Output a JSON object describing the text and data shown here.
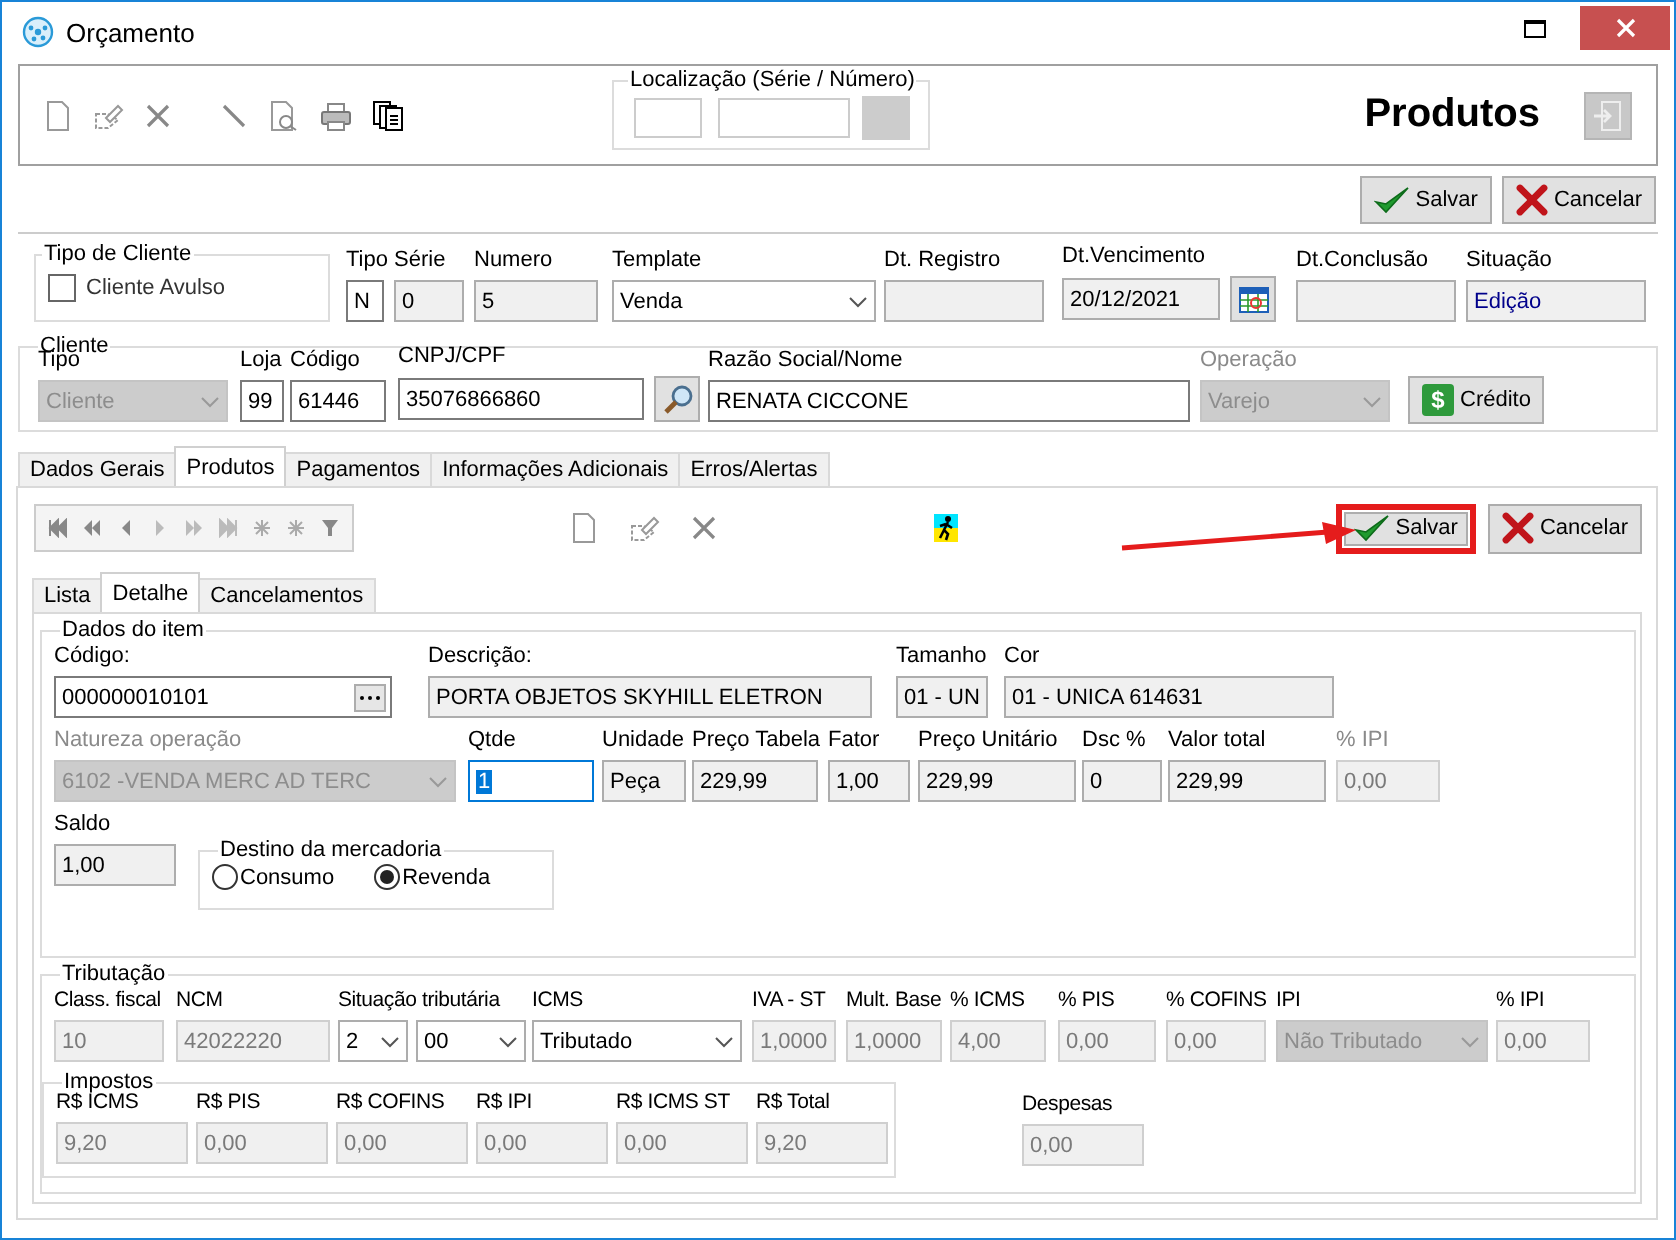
{
  "window": {
    "title": "Orçamento"
  },
  "location": {
    "legend": "Localização (Série / Número)"
  },
  "heading": "Produtos",
  "form_buttons": [
    {
      "kind": "save",
      "label": "Salvar",
      "highlighted": false
    },
    {
      "kind": "cancel",
      "label": "Cancelar",
      "highlighted": false
    }
  ],
  "client_type": {
    "legend": "Tipo de Cliente",
    "label": "Cliente Avulso",
    "checked": false
  },
  "header_fields": [
    {
      "label": "Tipo Série",
      "value": "N",
      "kind": "input"
    },
    {
      "value": "0",
      "kind": "readonly"
    },
    {
      "label": "Numero",
      "value": "5",
      "kind": "readonly"
    },
    {
      "label": "Template",
      "value": "Venda",
      "kind": "select"
    },
    {
      "label": "Dt. Registro",
      "kind": "readonly"
    },
    {
      "label": "Dt.Vencimento",
      "value": "20/12/2021",
      "kind": "date"
    },
    {
      "label": "Dt.Conclusão",
      "kind": "readonly"
    },
    {
      "label": "Situação",
      "value": "Edição",
      "kind": "status"
    }
  ],
  "client": {
    "legend": "Cliente",
    "fields": [
      {
        "label": "Tipo",
        "value": "Cliente",
        "kind": "select_disabled"
      },
      {
        "label": "Loja",
        "value": "99",
        "kind": "input"
      },
      {
        "label": "Código",
        "value": "61446",
        "kind": "input"
      },
      {
        "label": "CNPJ/CPF",
        "value": "35076866860",
        "kind": "search"
      },
      {
        "label": "Razão Social/Nome",
        "value": "RENATA CICCONE",
        "kind": "input"
      },
      {
        "label": "Operação",
        "value": "Varejo",
        "kind": "select_disabled",
        "label_greyed": true
      }
    ],
    "credit_button": "Crédito",
    "credit_icon": "$"
  },
  "tabs": [
    {
      "label": "Dados Gerais",
      "selected": false
    },
    {
      "label": "Produtos",
      "selected": true
    },
    {
      "label": "Pagamentos",
      "selected": false
    },
    {
      "label": "Informações Adicionais",
      "selected": false
    },
    {
      "label": "Erros/Alertas",
      "selected": false
    }
  ],
  "item_buttons": [
    {
      "kind": "save",
      "label": "Salvar",
      "highlighted": true
    },
    {
      "kind": "cancel",
      "label": "Cancelar",
      "highlighted": false
    }
  ],
  "subtabs": [
    {
      "label": "Lista",
      "selected": false
    },
    {
      "label": "Detalhe",
      "selected": true
    },
    {
      "label": "Cancelamentos",
      "selected": false
    }
  ],
  "item": {
    "legend": "Dados do item",
    "product_fields": [
      {
        "label": "Código:",
        "value": "000000010101",
        "kind": "lookup"
      },
      {
        "label": "Descrição:",
        "value": "PORTA OBJETOS SKYHILL ELETRON",
        "kind": "readonly"
      },
      {
        "label": "Tamanho",
        "value": "01 - UN",
        "kind": "readonly"
      },
      {
        "label": "Cor",
        "value": "01 - UNICA 614631",
        "kind": "readonly"
      }
    ],
    "value_fields": [
      {
        "label": "Natureza operação",
        "value": "6102 -VENDA MERC AD TERC",
        "kind": "select_disabled",
        "label_greyed": true
      },
      {
        "label": "Qtde",
        "value": "1",
        "kind": "focused"
      },
      {
        "label": "Unidade",
        "value": "Peça",
        "kind": "readonly"
      },
      {
        "label": "Preço Tabela",
        "value": "229,99",
        "kind": "readonly"
      },
      {
        "label": "Fator",
        "value": "1,00",
        "kind": "readonly"
      },
      {
        "label": "Preço Unitário",
        "value": "229,99",
        "kind": "readonly"
      },
      {
        "label": "Dsc %",
        "value": "0",
        "kind": "readonly"
      },
      {
        "label": "Valor total",
        "value": "229,99",
        "kind": "readonly"
      },
      {
        "label": "% IPI",
        "value": "0,00",
        "kind": "disabled",
        "label_greyed": true
      }
    ],
    "balance": {
      "label": "Saldo",
      "value": "1,00",
      "kind": "readonly"
    },
    "destination": {
      "legend": "Destino da mercadoria",
      "options": [
        {
          "label": "Consumo",
          "selected": false
        },
        {
          "label": "Revenda",
          "selected": true
        }
      ]
    }
  },
  "taxation": {
    "legend": "Tributação",
    "fields": [
      {
        "label": "Class. fiscal",
        "value": "10",
        "kind": "disabled"
      },
      {
        "label": "NCM",
        "value": "42022220",
        "kind": "disabled"
      },
      {
        "label": "Situação tributária",
        "value": "2",
        "kind": "select"
      },
      {
        "value": "00",
        "kind": "select"
      },
      {
        "label": "ICMS",
        "value": "Tributado",
        "kind": "select"
      },
      {
        "label": "IVA - ST",
        "value": "1,0000",
        "kind": "disabled"
      },
      {
        "label": "Mult. Base",
        "value": "1,0000",
        "kind": "disabled"
      },
      {
        "label": "% ICMS",
        "value": "4,00",
        "kind": "disabled"
      },
      {
        "label": "% PIS",
        "value": "0,00",
        "kind": "disabled"
      },
      {
        "label": "% COFINS",
        "value": "0,00",
        "kind": "disabled"
      },
      {
        "label": "IPI",
        "value": "Não Tributado",
        "kind": "select_disabled"
      },
      {
        "label": "% IPI",
        "value": "0,00",
        "kind": "disabled"
      }
    ],
    "taxes": {
      "legend": "Impostos",
      "fields": [
        {
          "label": "R$ ICMS",
          "value": "9,20",
          "kind": "disabled"
        },
        {
          "label": "R$ PIS",
          "value": "0,00",
          "kind": "disabled"
        },
        {
          "label": "R$ COFINS",
          "value": "0,00",
          "kind": "disabled"
        },
        {
          "label": "R$ IPI",
          "value": "0,00",
          "kind": "disabled"
        },
        {
          "label": "R$ ICMS ST",
          "value": "0,00",
          "kind": "disabled"
        },
        {
          "label": "R$ Total",
          "value": "9,20",
          "kind": "disabled"
        }
      ]
    },
    "expenses": {
      "label": "Despesas",
      "value": "0,00",
      "kind": "disabled"
    }
  }
}
